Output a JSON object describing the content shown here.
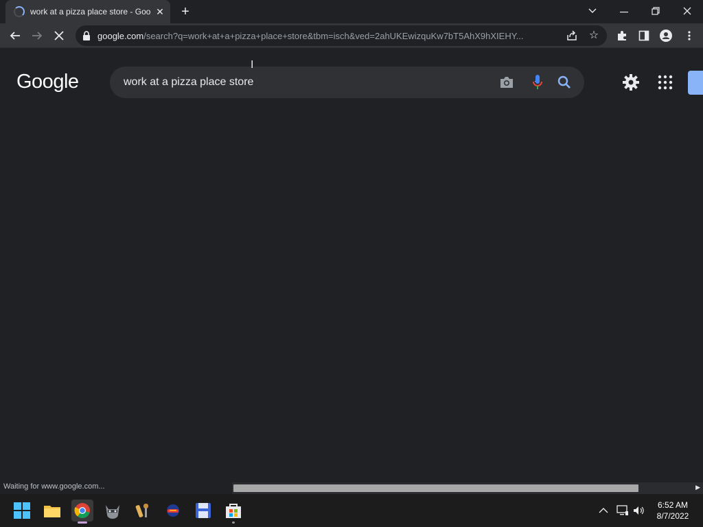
{
  "browser": {
    "tab_title": "work at a pizza place store - Goo",
    "url_host": "google.com",
    "url_path": "/search?q=work+at+a+pizza+place+store&tbm=isch&ved=2ahUKEwizquKw7bT5AhX9hXIEHY...",
    "status_text": "Waiting for www.google.com..."
  },
  "page": {
    "logo_text": "Google",
    "search_query": "work at a pizza place store"
  },
  "taskbar": {
    "time": "6:52 AM",
    "date": "8/7/2022"
  },
  "colors": {
    "background": "#202124",
    "toolbar": "#35363a",
    "searchbox": "#303134",
    "accent_blue": "#8ab4f8"
  }
}
